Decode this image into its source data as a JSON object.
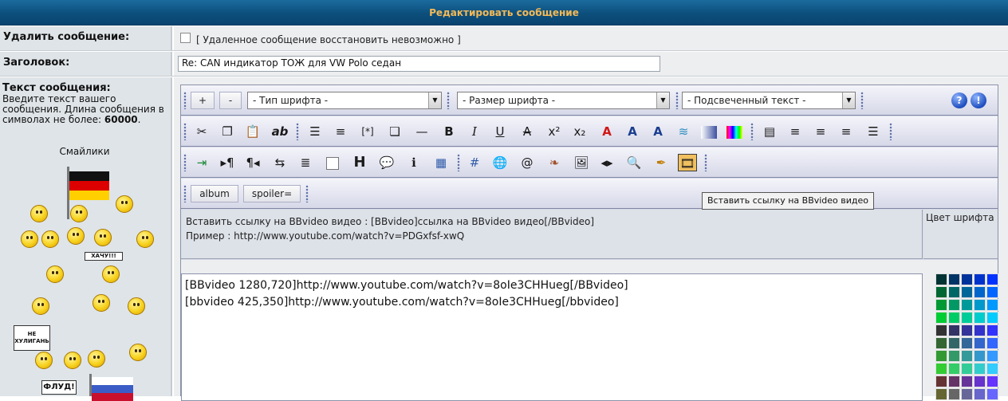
{
  "header": {
    "title": "Редактировать сообщение"
  },
  "delete": {
    "label": "Удалить сообщение:",
    "note": "[ Удаленное сообщение восстановить невозможно ]"
  },
  "subject": {
    "label": "Заголовок:",
    "value": "Re: CAN индикатор ТОЖ для VW Polo седан"
  },
  "message": {
    "label": "Текст сообщения:",
    "desc": "Введите текст вашего сообщения. Длина сообщения в символах не более:",
    "max": "60000",
    "smilies_title": "Смайлики",
    "sign_1": "НЕ ХУЛИГАНЬ",
    "sign_2": "ФЛУД!",
    "sign_3": "ХАЧУ!!!"
  },
  "toolbar": {
    "plus": "+",
    "minus": "-",
    "font_type": "- Тип шрифта -",
    "font_size": "- Размер шрифта -",
    "highlight": "- Подсвеченный текст -",
    "help": "?",
    "info": "!",
    "album": "album",
    "spoiler": "spoiler=",
    "tooltip": "Вставить ссылку на BBvideo видео"
  },
  "info": {
    "line1": "Вставить ссылку на BBvideo видео : [BBvideo]ссылка на BBvideo видео[/BBvideo]",
    "line2": "Пример : http://www.youtube.com/watch?v=PDGxfsf-xwQ",
    "font_color": "Цвет шрифта"
  },
  "textarea": {
    "line1": "[BBvideo 1280,720]http://www.youtube.com/watch?v=8oIe3CHHueg[/BBvideo]",
    "line2": "[bbvideo 425,350]http://www.youtube.com/watch?v=8oIe3CHHueg[/bbvideo]"
  },
  "colors": {
    "header": "#0c4f7c",
    "header_text": "#f4b957",
    "active_icon": "#f0c060"
  }
}
